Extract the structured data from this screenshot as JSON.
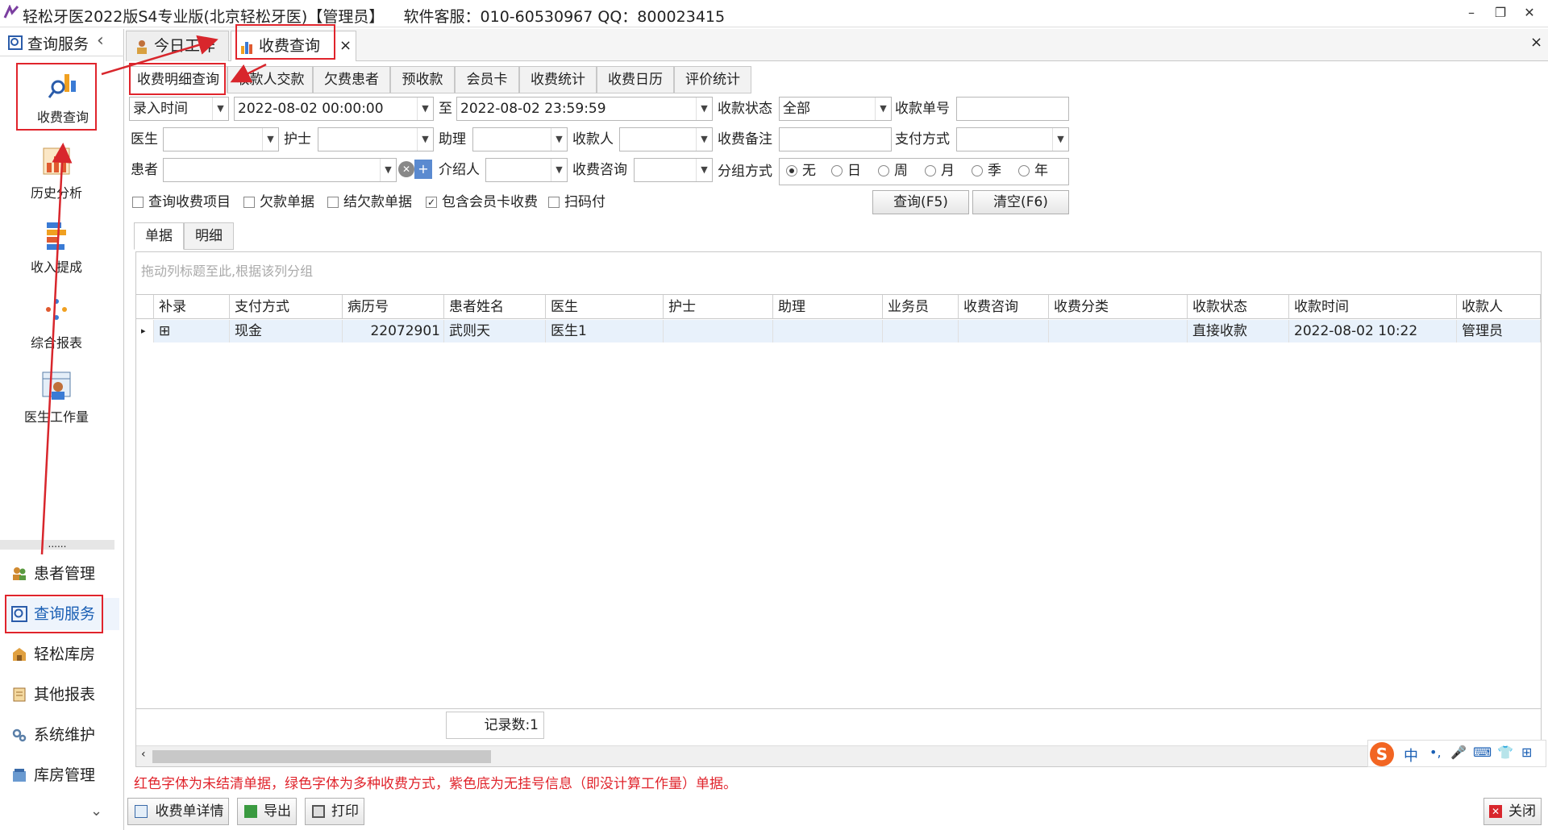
{
  "window": {
    "title": "轻松牙医2022版S4专业版(北京轻松牙医)【管理员】",
    "support": "软件客服：010-60530967 QQ：800023415",
    "min": "–",
    "restore": "❐",
    "close": "✕"
  },
  "sidebar": {
    "header": "查询服务",
    "collapse": "‹",
    "items": [
      {
        "label": "收费查询",
        "icon": "magnifier-chart-icon"
      },
      {
        "label": "历史分析",
        "icon": "bar-chart-icon"
      },
      {
        "label": "收入提成",
        "icon": "stack-bars-icon"
      },
      {
        "label": "综合报表",
        "icon": "dots-icon"
      },
      {
        "label": "医生工作量",
        "icon": "doctor-calendar-icon"
      }
    ],
    "splitter": "......",
    "nav": [
      {
        "label": "患者管理",
        "icon": "patients-icon"
      },
      {
        "label": "查询服务",
        "icon": "query-icon"
      },
      {
        "label": "轻松库房",
        "icon": "warehouse-icon"
      },
      {
        "label": "其他报表",
        "icon": "report-icon"
      },
      {
        "label": "系统维护",
        "icon": "gears-icon"
      },
      {
        "label": "库房管理",
        "icon": "store-icon"
      }
    ],
    "more": "⌄"
  },
  "tabs": [
    {
      "label": "今日工作"
    },
    {
      "label": "收费查询"
    }
  ],
  "tab_close": "×",
  "panel_close": "×",
  "subtabs": [
    "收费明细查询",
    "收款人交款",
    "欠费患者",
    "预收款",
    "会员卡",
    "收费统计",
    "收费日历",
    "评价统计"
  ],
  "filters": {
    "time_type": "录入时间",
    "start": "2022-08-02 00:00:00",
    "to": "至",
    "end": "2022-08-02 23:59:59",
    "status_label": "收款状态",
    "status_value": "全部",
    "bill_no_label": "收款单号",
    "doctor_label": "医生",
    "nurse_label": "护士",
    "assistant_label": "助理",
    "payee_label": "收款人",
    "remark_label": "收费备注",
    "pay_method_label": "支付方式",
    "patient_label": "患者",
    "referrer_label": "介绍人",
    "consult_label": "收费咨询",
    "group_label": "分组方式",
    "group_options": [
      "无",
      "日",
      "周",
      "月",
      "季",
      "年"
    ],
    "checks": [
      {
        "label": "查询收费项目",
        "checked": false
      },
      {
        "label": "欠款单据",
        "checked": false
      },
      {
        "label": "结欠款单据",
        "checked": false
      },
      {
        "label": "包含会员卡收费",
        "checked": true
      },
      {
        "label": "扫码付",
        "checked": false
      }
    ],
    "query_btn": "查询(F5)",
    "clear_btn": "清空(F6)"
  },
  "result_tabs": [
    "单据",
    "明细"
  ],
  "grid": {
    "group_hint": "拖动列标题至此,根据该列分组",
    "columns": [
      "补录",
      "支付方式",
      "病历号",
      "患者姓名",
      "医生",
      "护士",
      "助理",
      "业务员",
      "收费咨询",
      "收费分类",
      "收款状态",
      "收款时间",
      "收款人"
    ],
    "rows": [
      {
        "expand": "⊞",
        "pay": "现金",
        "record": "22072901",
        "name": "武则天",
        "doctor": "医生1",
        "nurse": "",
        "assistant": "",
        "sales": "",
        "consult": "",
        "category": "",
        "status": "直接收款",
        "time": "2022-08-02 10:22",
        "payee": "管理员"
      }
    ],
    "record_count": "记录数:1"
  },
  "legend": "红色字体为未结清单据，绿色字体为多种收费方式，紫色底为无挂号信息（即没计算工作量）单据。",
  "bottom": {
    "detail": "收费单详情",
    "export": "导出",
    "print": "打印",
    "close": "关闭"
  },
  "ime": {
    "logo": "S",
    "items": [
      "中",
      "•,",
      "🎤",
      "⌨",
      "👕",
      "⊞"
    ]
  },
  "colors": {
    "accent": "#1a5fb4",
    "annotation": "#e0242c",
    "legend": "#e0242c"
  }
}
